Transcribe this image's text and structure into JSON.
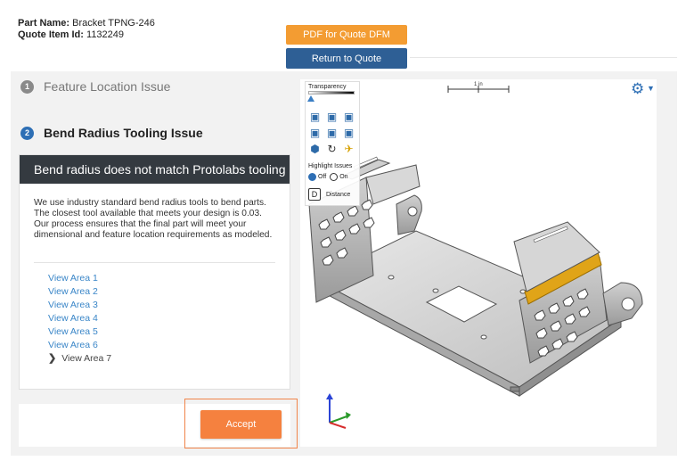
{
  "header": {
    "part_name_label": "Part Name:",
    "part_name_value": "Bracket TPNG-246",
    "quote_item_label": "Quote Item Id:",
    "quote_item_value": "1132249",
    "pdf_button": "PDF for Quote DFM",
    "return_button": "Return to Quote"
  },
  "issues": [
    {
      "number": "1",
      "title": "Feature Location Issue"
    },
    {
      "number": "2",
      "title": "Bend Radius Tooling Issue"
    }
  ],
  "card": {
    "heading": "Bend radius does not match Protolabs tooling",
    "body": "We use industry standard bend radius tools to bend parts. The closest tool available that meets your design is 0.03. Our process ensures that the final part will meet your dimensional and feature location requirements as modeled.",
    "links": [
      "View Area 1",
      "View Area 2",
      "View Area 3",
      "View Area 4",
      "View Area 5",
      "View Area 6"
    ],
    "current_area": "View Area 7"
  },
  "accept_button": "Accept",
  "viewer": {
    "transparency_label": "Transparency",
    "highlight_label": "Highlight Issues",
    "off_label": "Off",
    "on_label": "On",
    "distance_key": "D",
    "distance_label": "Distance",
    "scale_label": "1 in",
    "icons": [
      "cube-front-icon",
      "cube-side-icon",
      "cube-top-icon",
      "cube-iso-left-icon",
      "cube-iso-right-icon",
      "cube-back-icon",
      "cube-shaded-icon",
      "rotate-icon",
      "rocket-icon",
      "settings-gear-icon",
      "axis-triad-icon"
    ],
    "colors": {
      "highlight": "#e0a418",
      "accent_blue": "#2e6fb5",
      "accent_orange": "#f5813f"
    }
  }
}
